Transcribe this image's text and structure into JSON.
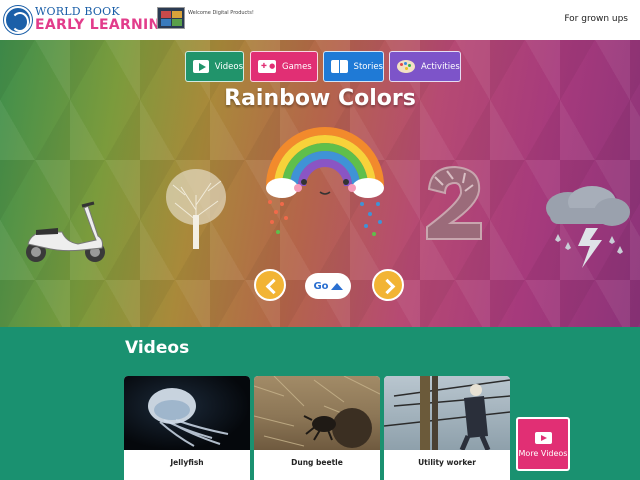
{
  "header": {
    "logo_line1": "WORLD BOOK",
    "logo_line2": "EARLY LEARNING",
    "welcome_text": "Welcome Digital Products!",
    "grown_ups_link": "For grown ups"
  },
  "nav": [
    {
      "label": "Videos",
      "icon": "video-icon",
      "color": "#21946b"
    },
    {
      "label": "Games",
      "icon": "gamepad-icon",
      "color": "#e12f74"
    },
    {
      "label": "Stories",
      "icon": "book-icon",
      "color": "#1f7ad6"
    },
    {
      "label": "Activities",
      "icon": "palette-icon",
      "color": "#7d54c9"
    }
  ],
  "carousel": {
    "title": "Rainbow Colors",
    "go_label": "Go",
    "items": [
      "scooter",
      "tree",
      "rainbow",
      "number-two",
      "storm-cloud"
    ]
  },
  "videos": {
    "title": "Videos",
    "cards": [
      {
        "caption": "Jellyfish"
      },
      {
        "caption": "Dung beetle"
      },
      {
        "caption": "Utility worker"
      }
    ],
    "more_label": "More Videos"
  },
  "colors": {
    "videos_green": "#1a9170",
    "games_pink": "#e12f74",
    "stories_blue": "#1f7ad6",
    "activities_purple": "#7d54c9",
    "arrow_yellow": "#f2b434"
  }
}
